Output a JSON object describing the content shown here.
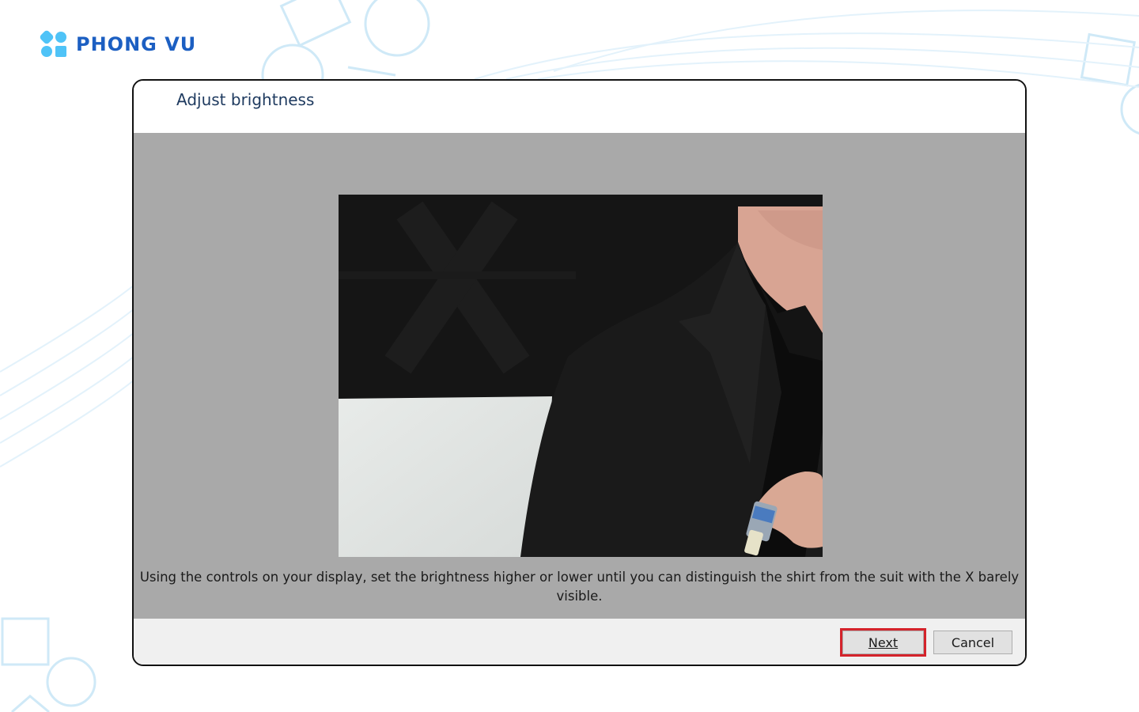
{
  "brand": {
    "name": "PHONG VU",
    "color": "#1c5fc2",
    "accent": "#4fc3f7"
  },
  "dialog": {
    "title": "Adjust brightness",
    "instruction": "Using the controls on your display, set the brightness higher or lower until you can distinguish the shirt from the suit with the X barely visible.",
    "image": "brightness-calibration-image (man in black suit and shirt with faint X in background)",
    "buttons": {
      "next": "Next",
      "cancel": "Cancel"
    },
    "highlight_color": "#d4232b"
  }
}
